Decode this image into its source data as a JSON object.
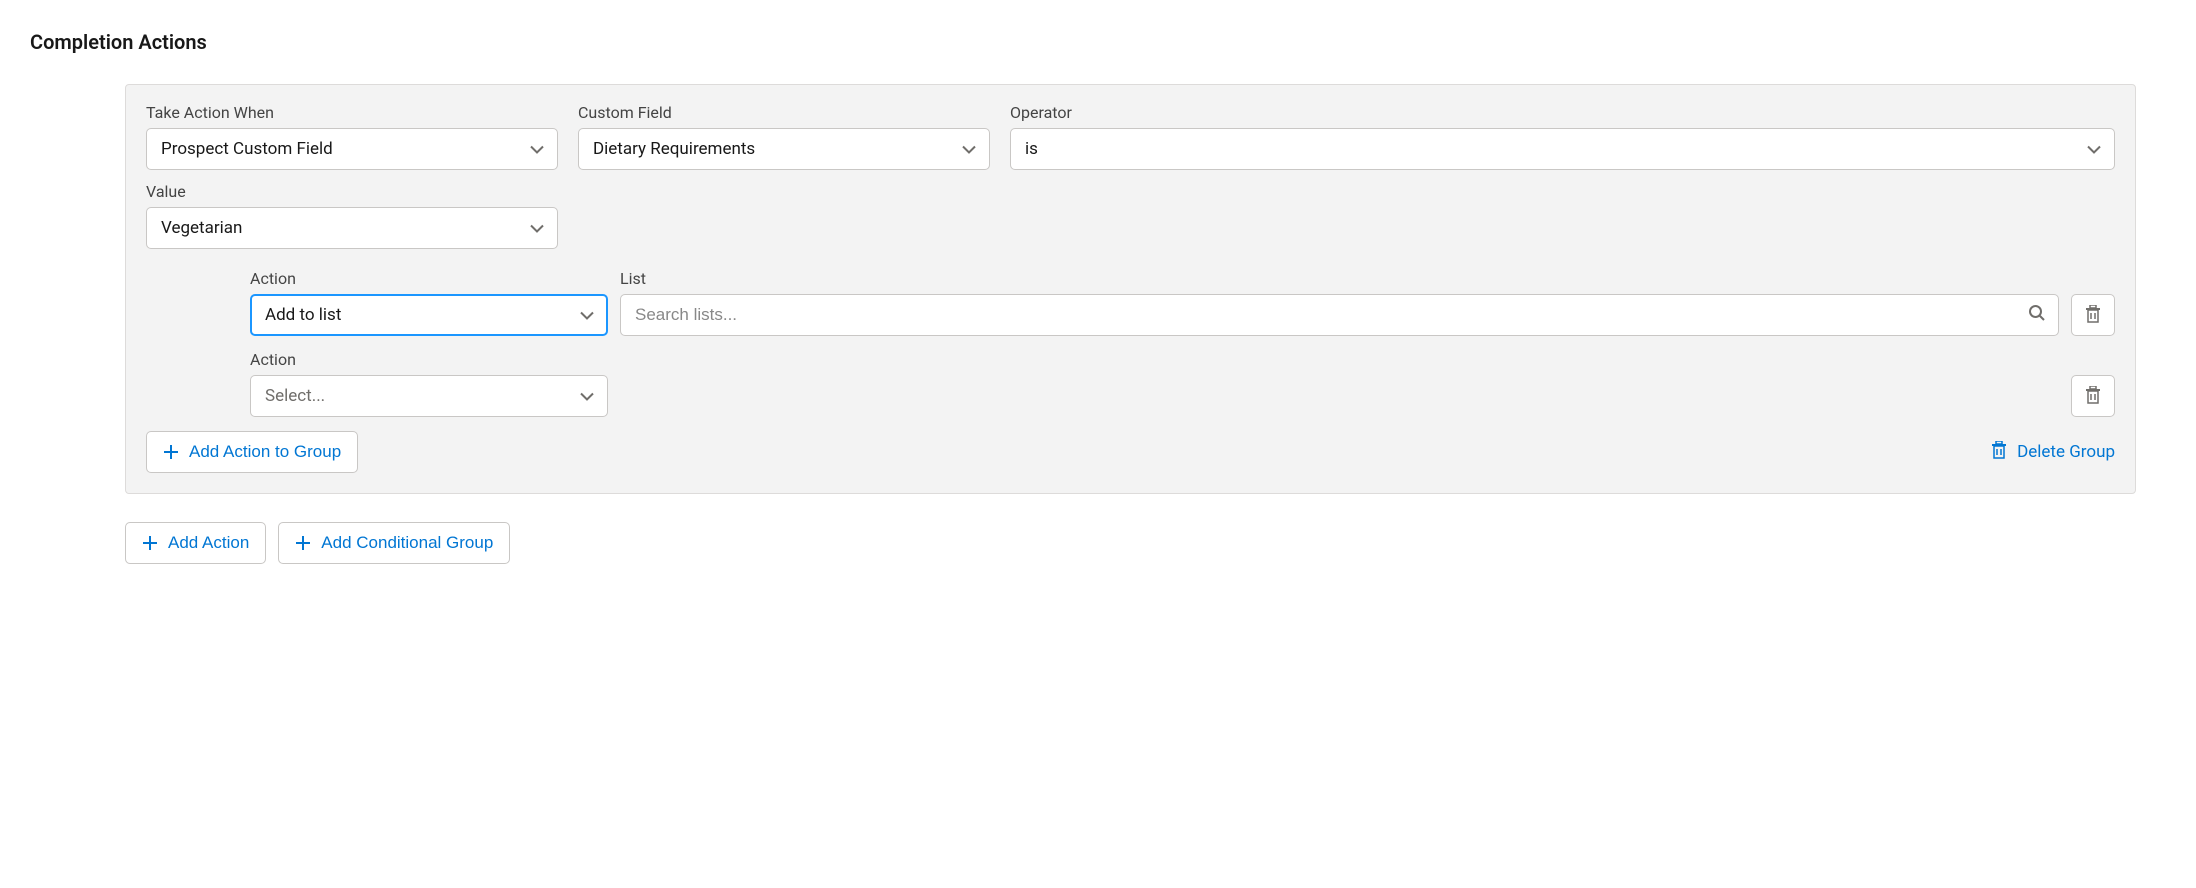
{
  "page_title": "Completion Actions",
  "condition": {
    "take_action_when": {
      "label": "Take Action When",
      "value": "Prospect Custom Field"
    },
    "custom_field": {
      "label": "Custom Field",
      "value": "Dietary Requirements"
    },
    "operator": {
      "label": "Operator",
      "value": "is"
    },
    "value": {
      "label": "Value",
      "value": "Vegetarian"
    }
  },
  "actions": [
    {
      "action_label": "Action",
      "action_value": "Add to list",
      "list_label": "List",
      "list_placeholder": "Search lists..."
    },
    {
      "action_label": "Action",
      "action_value": "Select..."
    }
  ],
  "buttons": {
    "add_action_to_group": "Add Action to Group",
    "delete_group": "Delete Group",
    "add_action": "Add Action",
    "add_conditional_group": "Add Conditional Group"
  }
}
